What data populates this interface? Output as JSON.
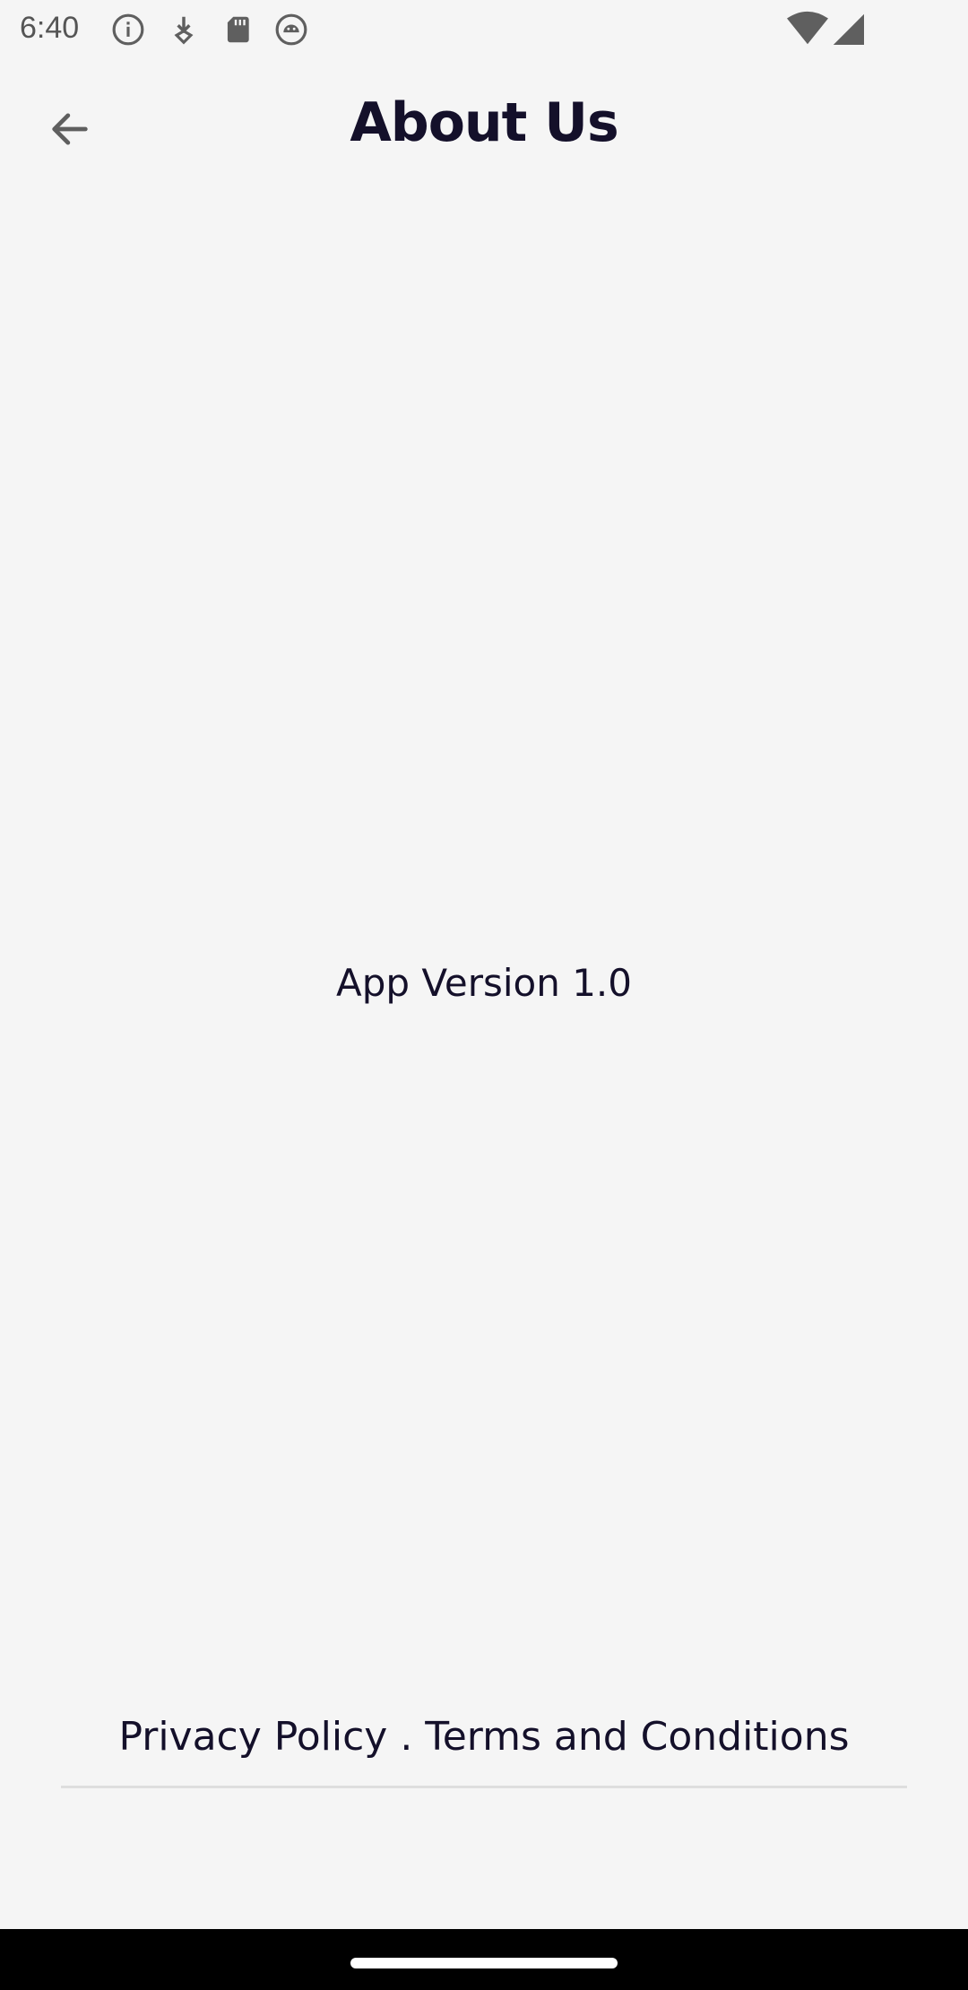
{
  "status_bar": {
    "time": "6:40",
    "left_icons": [
      "info-icon",
      "download-icon",
      "sd-card-icon",
      "android-icon"
    ],
    "right_icons": [
      "wifi-icon",
      "signal-icon"
    ]
  },
  "header": {
    "title": "About Us",
    "back_icon": "arrow-left-icon"
  },
  "main": {
    "app_version": "App Version 1.0"
  },
  "footer": {
    "privacy_policy": "Privacy Policy",
    "separator": " . ",
    "terms": "Terms and Conditions"
  },
  "colors": {
    "background": "#f5f5f5",
    "text": "#14102a",
    "icon": "#5f5f5f",
    "nav_bar": "#000000"
  }
}
